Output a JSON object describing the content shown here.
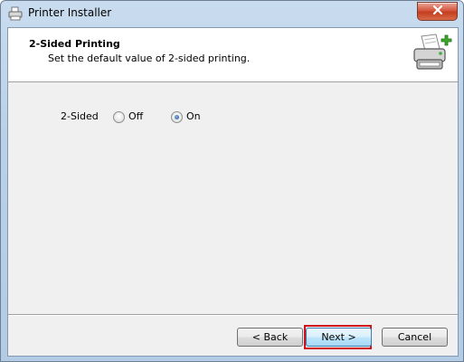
{
  "window": {
    "title": "Printer Installer",
    "app_icon": "printer-installer-icon",
    "close_icon": "close-x-icon"
  },
  "header": {
    "title": "2-Sided Printing",
    "subtitle": "Set the default value of 2-sided printing.",
    "icon": "printer-add-icon"
  },
  "duplex": {
    "label": "2-Sided",
    "options": [
      {
        "label": "Off",
        "selected": false
      },
      {
        "label": "On",
        "selected": true
      }
    ]
  },
  "buttons": {
    "back": "< Back",
    "next": "Next >",
    "cancel": "Cancel"
  },
  "colors": {
    "focus_highlight": "#d0101a",
    "title_bar": "#b9d0e8",
    "close_button": "#c33d1f"
  }
}
